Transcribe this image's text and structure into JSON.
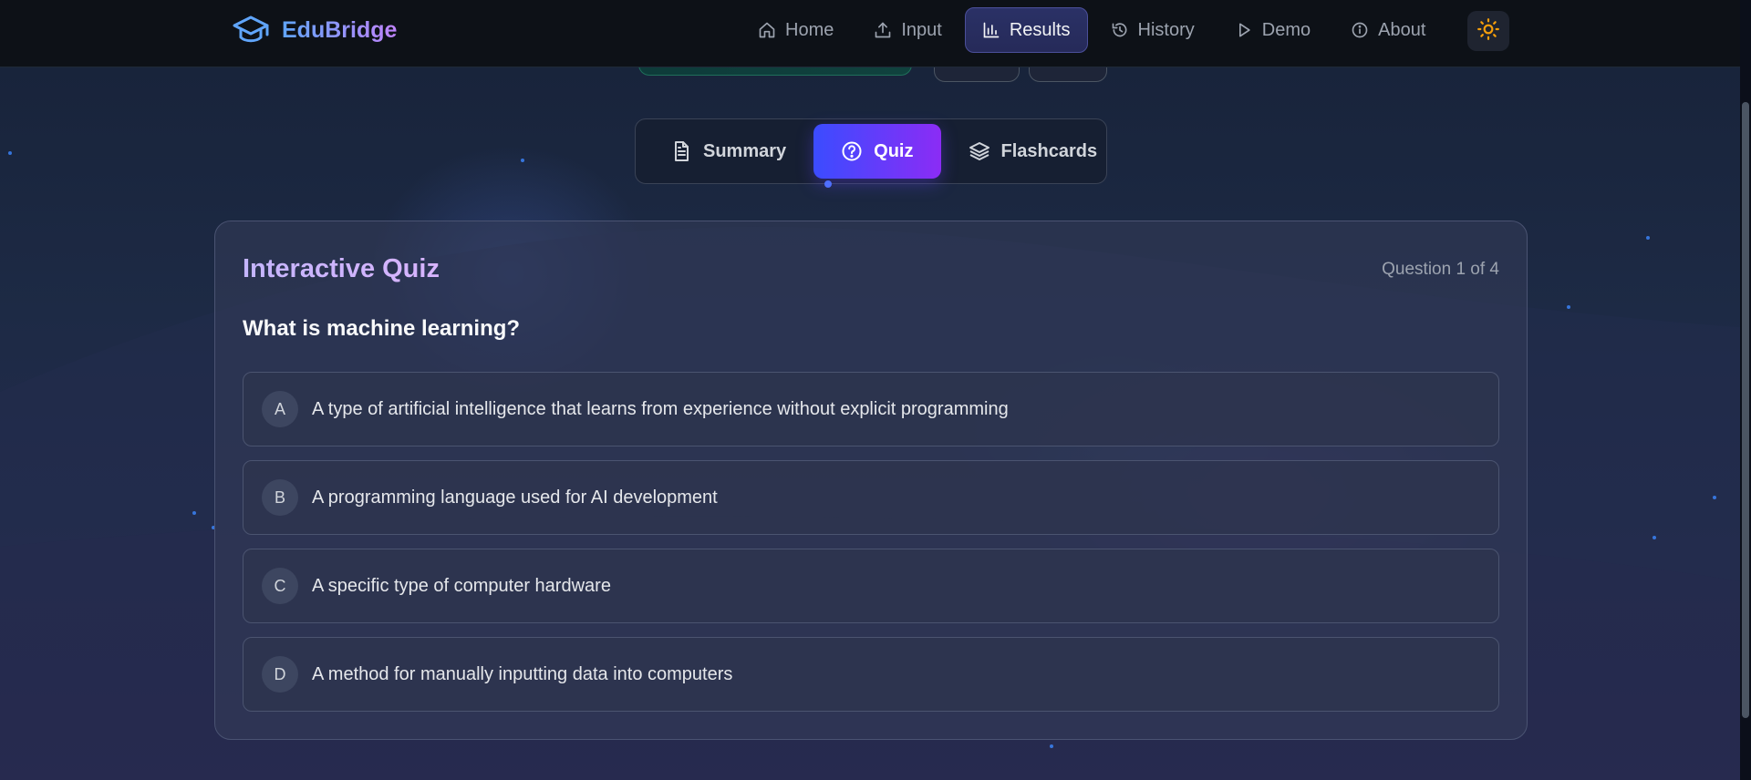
{
  "app": {
    "name": "EduBridge",
    "logo_icon": "graduation-cap-icon"
  },
  "nav": {
    "items": [
      {
        "label": "Home",
        "icon": "home-icon"
      },
      {
        "label": "Input",
        "icon": "upload-icon"
      },
      {
        "label": "Results",
        "icon": "bar-chart-icon",
        "active": true
      },
      {
        "label": "History",
        "icon": "history-icon"
      },
      {
        "label": "Demo",
        "icon": "play-icon"
      },
      {
        "label": "About",
        "icon": "info-icon"
      }
    ],
    "theme_toggle_icon": "sun-icon"
  },
  "tabs": [
    {
      "label": "Summary",
      "icon": "document-icon"
    },
    {
      "label": "Quiz",
      "icon": "help-circle-icon",
      "active": true
    },
    {
      "label": "Flashcards",
      "icon": "layers-icon"
    }
  ],
  "quiz": {
    "title": "Interactive Quiz",
    "counter": "Question 1 of 4",
    "question": "What is machine learning?",
    "options": [
      {
        "letter": "A",
        "text": "A type of artificial intelligence that learns from experience without explicit programming"
      },
      {
        "letter": "B",
        "text": "A programming language used for AI development"
      },
      {
        "letter": "C",
        "text": "A specific type of computer hardware"
      },
      {
        "letter": "D",
        "text": "A method for manually inputting data into computers"
      }
    ]
  },
  "colors": {
    "accent_start": "#3b4cff",
    "accent_end": "#8b2cf5",
    "brand_start": "#60a5fa",
    "brand_end": "#c084fc",
    "sun": "#f59e0b"
  }
}
